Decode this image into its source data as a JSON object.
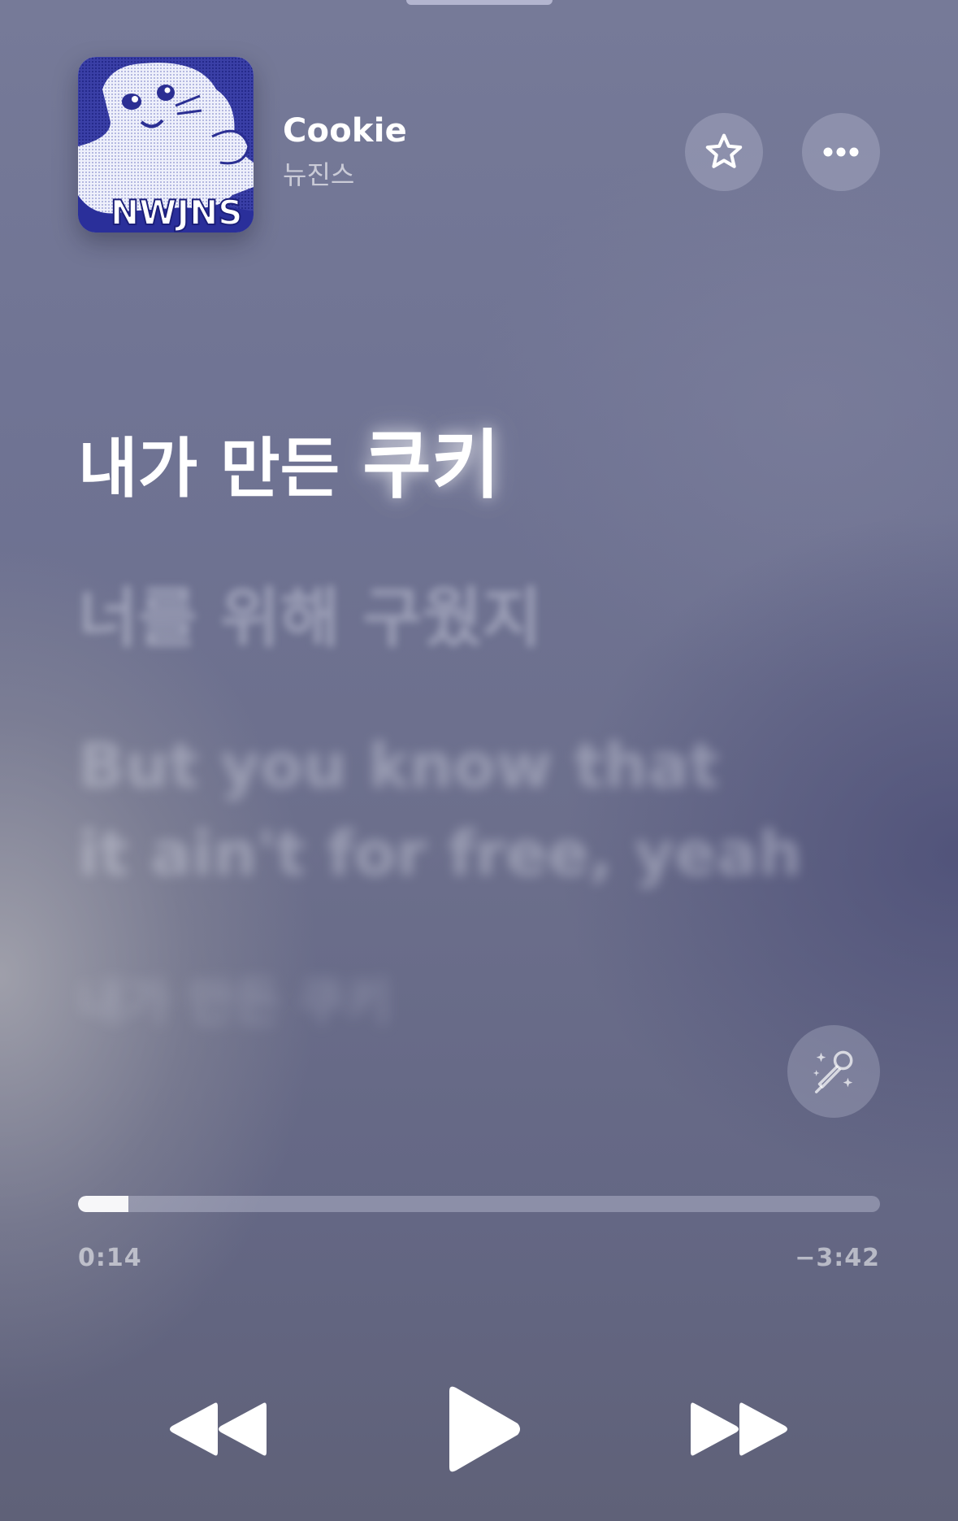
{
  "now_playing": {
    "title": "Cookie",
    "artist": "뉴진스",
    "artwork_text": "NWJNS"
  },
  "header_buttons": {
    "favorite_icon": "star-outline-icon",
    "more_icon": "ellipsis-icon"
  },
  "lyrics": {
    "active_sung": "내가 만든 ",
    "active_current": "쿠키",
    "next": "너를 위해 구웠지",
    "following_line1": "But you know that",
    "following_line2": "it ain't for free, yeah",
    "later": "내가 만든 쿠키"
  },
  "sing_button_icon": "microphone-sparkles-icon",
  "playback": {
    "elapsed": "0:14",
    "remaining": "−3:42",
    "progress_fraction": 0.063
  },
  "controls": {
    "rewind_icon": "backward-icon",
    "play_icon": "play-icon",
    "forward_icon": "forward-icon"
  },
  "colors": {
    "background_top": "#767a98",
    "background_bottom": "#5f6178",
    "artwork_blue": "#2a2f9a"
  }
}
